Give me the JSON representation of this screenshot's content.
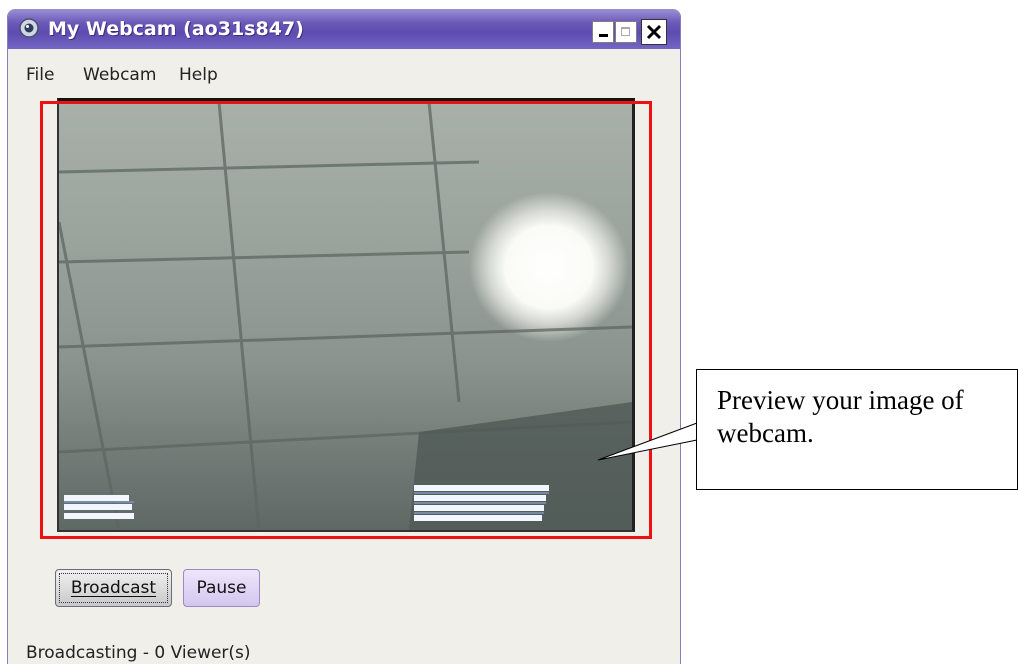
{
  "window": {
    "title": "My Webcam (ao31s847)"
  },
  "menu": {
    "file": "File",
    "webcam": "Webcam",
    "help": "Help"
  },
  "buttons": {
    "broadcast_label": "Broadcast",
    "pause_label": "Pause"
  },
  "status": {
    "text": "Broadcasting - 0 Viewer(s)"
  },
  "callout": {
    "text": "Preview your image of webcam."
  },
  "colors": {
    "titlebar": "#6a59b8",
    "annotation_border": "#ee1111",
    "pause_button": "#d3c6ef"
  },
  "icons": {
    "app": "webcam-icon",
    "minimize": "minimize-icon",
    "maximize": "maximize-icon",
    "close": "close-icon"
  }
}
